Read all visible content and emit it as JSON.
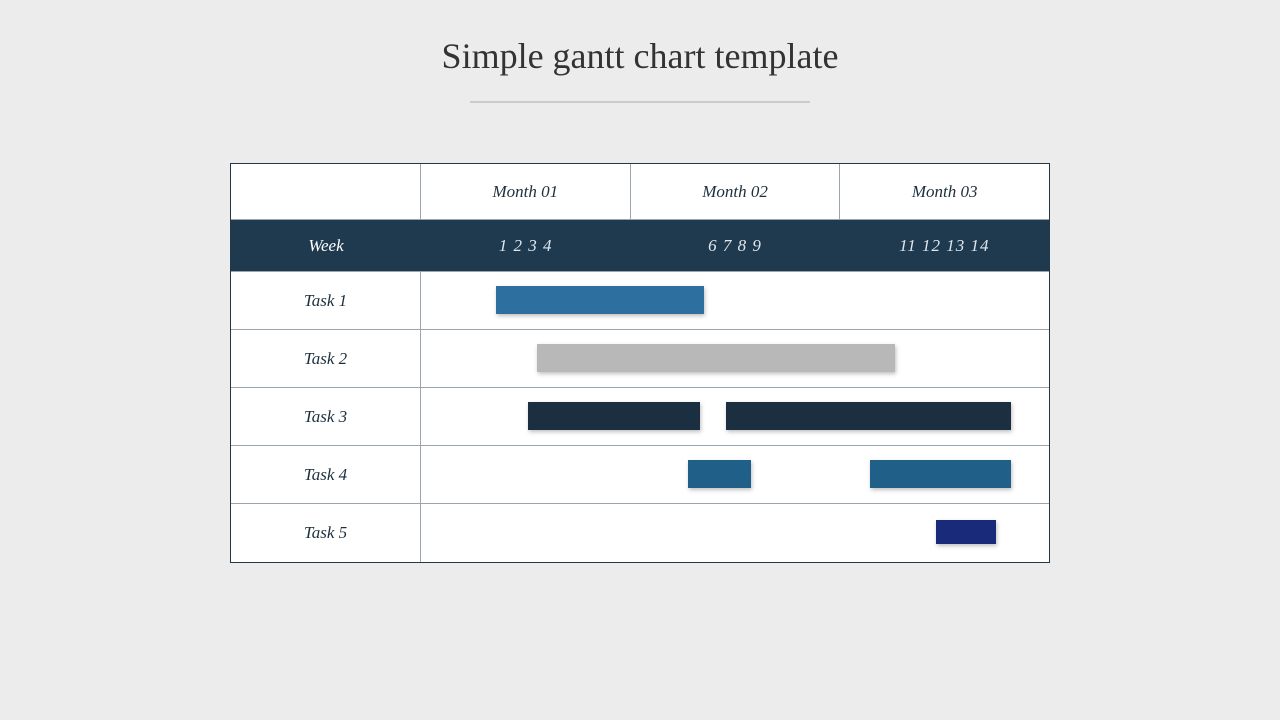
{
  "title": "Simple gantt chart template",
  "header": {
    "months": [
      "Month 01",
      "Month 02",
      "Month 03"
    ],
    "week_label": "Week",
    "week_groups": [
      "1 2 3 4",
      "6 7 8 9",
      "11 12 13 14"
    ]
  },
  "tasks": [
    "Task 1",
    "Task 2",
    "Task 3",
    "Task 4",
    "Task 5"
  ],
  "chart_data": {
    "type": "gantt",
    "title": "Simple gantt chart template",
    "x_axis_label": "Week",
    "x_range": [
      1,
      14
    ],
    "months": [
      {
        "name": "Month 01",
        "weeks": [
          1,
          2,
          3,
          4
        ]
      },
      {
        "name": "Month 02",
        "weeks": [
          6,
          7,
          8,
          9
        ]
      },
      {
        "name": "Month 03",
        "weeks": [
          11,
          12,
          13,
          14
        ]
      }
    ],
    "tasks": [
      {
        "name": "Task 1",
        "bars": [
          {
            "start": 2,
            "end": 7,
            "color": "#2d70a0"
          }
        ]
      },
      {
        "name": "Task 2",
        "bars": [
          {
            "start": 3,
            "end": 11,
            "color": "#b8b8b8"
          }
        ]
      },
      {
        "name": "Task 3",
        "bars": [
          {
            "start": 3,
            "end": 7,
            "color": "#1b2f41"
          },
          {
            "start": 7.5,
            "end": 14,
            "color": "#1b2f41"
          }
        ]
      },
      {
        "name": "Task 4",
        "bars": [
          {
            "start": 7,
            "end": 8,
            "color": "#1f5f88"
          },
          {
            "start": 11,
            "end": 14,
            "color": "#1f5f88"
          }
        ]
      },
      {
        "name": "Task 5",
        "bars": [
          {
            "start": 12.5,
            "end": 14,
            "color": "#1a2a7a"
          }
        ]
      }
    ]
  },
  "colors": {
    "background": "#ececec",
    "table_border": "#22384a",
    "cell_border": "#9aa5ae",
    "week_row_bg": "#1f3a4f"
  }
}
